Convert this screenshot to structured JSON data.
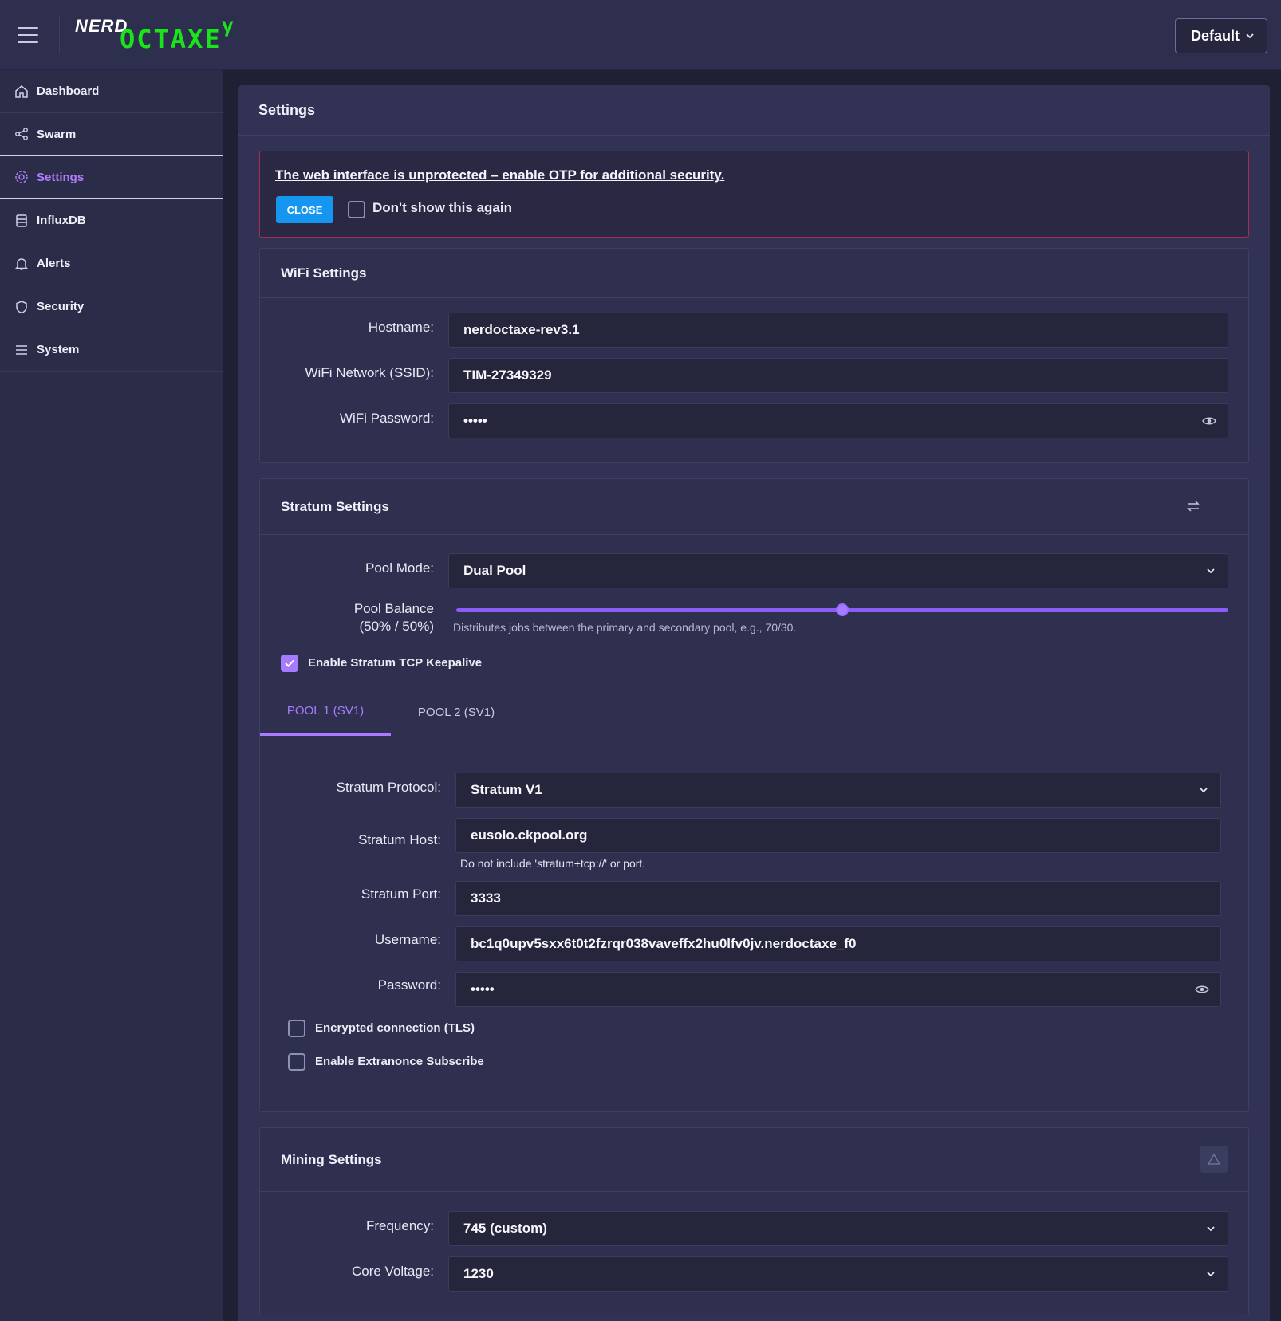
{
  "header": {
    "logo": {
      "part1": "NERD",
      "part2": "OCTAXE",
      "part3": "γ"
    },
    "profile_select": "Default"
  },
  "sidebar": {
    "items": [
      {
        "label": "Dashboard",
        "icon": "home-icon"
      },
      {
        "label": "Swarm",
        "icon": "share-icon"
      },
      {
        "label": "Settings",
        "icon": "gear-icon"
      },
      {
        "label": "InfluxDB",
        "icon": "database-icon"
      },
      {
        "label": "Alerts",
        "icon": "bell-icon"
      },
      {
        "label": "Security",
        "icon": "shield-icon"
      },
      {
        "label": "System",
        "icon": "list-icon"
      }
    ],
    "active": "Settings"
  },
  "page": {
    "title": "Settings"
  },
  "alert": {
    "text": "The web interface is unprotected – enable OTP for additional security.",
    "close_label": "CLOSE",
    "dont_show_label": "Don't show this again",
    "dont_show_checked": false
  },
  "wifi": {
    "title": "WiFi Settings",
    "hostname_label": "Hostname:",
    "hostname_value": "nerdoctaxe-rev3.1",
    "ssid_label": "WiFi Network (SSID):",
    "ssid_value": "TIM-27349329",
    "password_label": "WiFi Password:",
    "password_value": "•••••"
  },
  "stratum": {
    "title": "Stratum Settings",
    "pool_mode_label": "Pool Mode:",
    "pool_mode_value": "Dual Pool",
    "pool_balance_label": "Pool Balance",
    "pool_balance_value": "(50% / 50%)",
    "pool_balance_fraction": 0.5,
    "pool_balance_help": "Distributes jobs between the primary and secondary pool, e.g., 70/30.",
    "keepalive_label": "Enable Stratum TCP Keepalive",
    "keepalive_checked": true,
    "tabs": [
      "POOL 1 (SV1)",
      "POOL 2 (SV1)"
    ],
    "active_tab": "POOL 1 (SV1)",
    "protocol_label": "Stratum Protocol:",
    "protocol_value": "Stratum V1",
    "host_label": "Stratum Host:",
    "host_value": "eusolo.ckpool.org",
    "host_help": "Do not include 'stratum+tcp://' or port.",
    "port_label": "Stratum Port:",
    "port_value": "3333",
    "username_label": "Username:",
    "username_value": "bc1q0upv5sxx6t0t2fzrqr038vaveffx2hu0lfv0jv.nerdoctaxe_f0",
    "password_label": "Password:",
    "password_value": "•••••",
    "tls_label": "Encrypted connection (TLS)",
    "tls_checked": false,
    "extranonce_label": "Enable Extranonce Subscribe",
    "extranonce_checked": false
  },
  "mining": {
    "title": "Mining Settings",
    "frequency_label": "Frequency:",
    "frequency_value": "745 (custom)",
    "voltage_label": "Core Voltage:",
    "voltage_value": "1230"
  },
  "colors": {
    "accent": "#a57bff",
    "logo_green": "#19e619",
    "alert_border": "#a82e4d",
    "button_blue": "#1596f0"
  }
}
